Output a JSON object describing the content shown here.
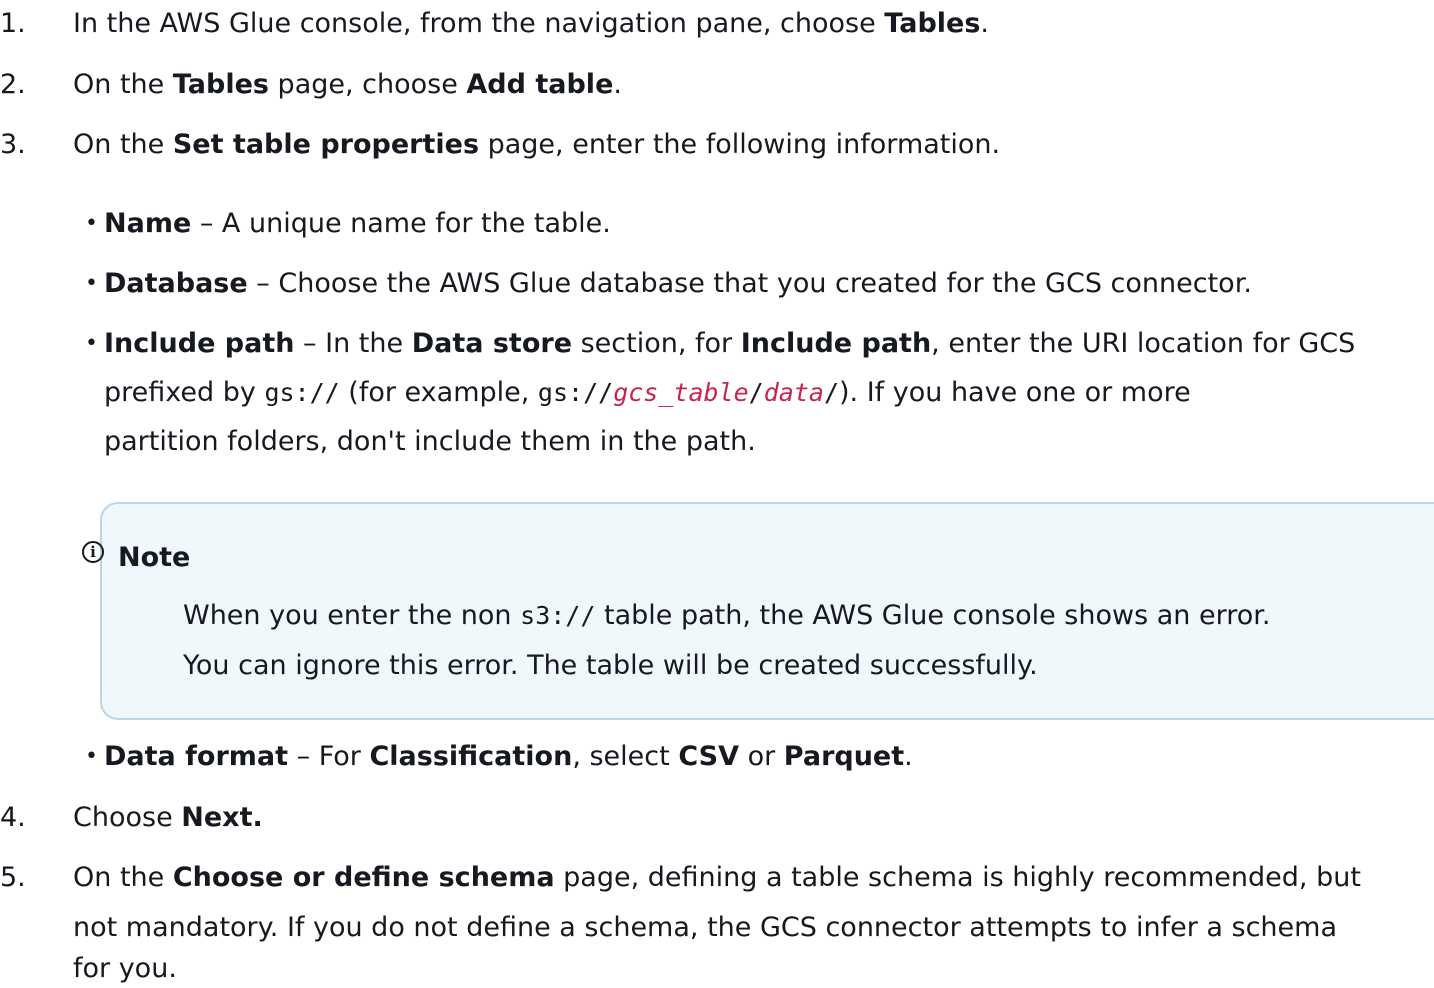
{
  "steps": [
    {
      "num": "1.",
      "pre": "In the AWS Glue console, from the navigation pane, choose ",
      "bold": "Tables",
      "post": "."
    },
    {
      "num": "2.",
      "pre": "On the ",
      "bold1": "Tables",
      "mid": " page, choose ",
      "bold2": "Add table",
      "post": "."
    },
    {
      "num": "3.",
      "pre": "On the ",
      "bold": "Set table properties",
      "post": " page, enter the following information."
    },
    {
      "num": "4.",
      "pre": "Choose ",
      "bold": "Next."
    },
    {
      "num": "5.",
      "pre": "On the ",
      "bold": "Choose or define schema",
      "post": " page, defining a table schema is highly recommended, but",
      "line2": "not mandatory. If you do not define a schema, the GCS connector attempts to infer a schema",
      "line3": "for you."
    }
  ],
  "bullets": {
    "name": {
      "label": "Name",
      "text": " – A unique name for the table."
    },
    "database": {
      "label": "Database",
      "text": " – Choose the AWS Glue database that you created for the GCS connector."
    },
    "include_path": {
      "label": "Include path",
      "t1": " – In the ",
      "b1": "Data store",
      "t2": " section, for ",
      "b2": "Include path",
      "t3": ", enter the URI location for GCS",
      "l2a": "prefixed by ",
      "code1": "gs://",
      "l2b": " (for example, ",
      "code2": "gs://",
      "var1": "gcs_table",
      "slash1": "/",
      "var2": "data",
      "slash2": "/",
      "l2c": "). If you have one or more",
      "l3": "partition folders, don't include them in the path."
    },
    "data_format": {
      "label": "Data format",
      "t1": " – For ",
      "b1": "Classification",
      "t2": ", select ",
      "b2": "CSV",
      "t3": " or ",
      "b3": "Parquet",
      "t4": "."
    }
  },
  "note": {
    "icon": "info-icon",
    "title": "Note",
    "l1a": "When you enter the non ",
    "code": "s3://",
    "l1b": " table path, the AWS Glue console shows an error.",
    "l2": "You can ignore this error. The table will be created successfully."
  },
  "bullet_glyph": "•",
  "icon_glyph": "i"
}
